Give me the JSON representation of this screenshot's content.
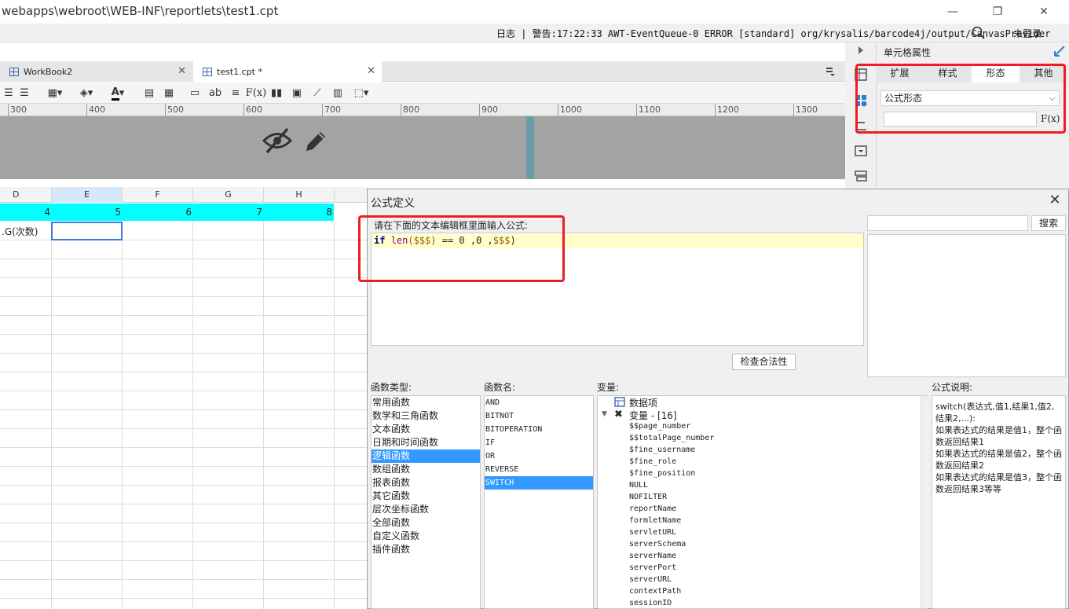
{
  "window": {
    "title": "webapps\\webroot\\WEB-INF\\reportlets\\test1.cpt",
    "minimize": "—",
    "maximize": "❐",
    "close": "✕"
  },
  "logbar": {
    "log_text": "日志 | 警告:17:22:33 AWT-EventQueue-0 ERROR [standard] org/krysalis/barcode4j/output/CanvasProvider",
    "login": "未登录"
  },
  "tabs": [
    {
      "label": "WorkBook2",
      "close": "✕"
    },
    {
      "label": "test1.cpt *",
      "close": "✕"
    }
  ],
  "toolbar": {
    "ab_label": "ab",
    "fx_label": "F(x)"
  },
  "ruler": [
    "300",
    "400",
    "500",
    "600",
    "700",
    "800",
    "900",
    "1000",
    "1100",
    "1200",
    "1300"
  ],
  "columns": [
    "D",
    "E",
    "F",
    "G",
    "H"
  ],
  "cyan_row": [
    "4",
    "5",
    "6",
    "7",
    "8"
  ],
  "cell_d2": ".G(次数)",
  "right_panel": {
    "title": "单元格属性",
    "tabs": [
      "扩展",
      "样式",
      "形态",
      "其他"
    ],
    "active_tab": "形态",
    "select_value": "公式形态",
    "fx_button": "F(x)"
  },
  "dialog": {
    "title": "公式定义",
    "prompt": "请在下面的文本编辑框里面输入公式:",
    "formula": {
      "kw": "if",
      "fn": "len",
      "arg1": "($$$)",
      "rest": " == 0 ,0 ,",
      "arg2": "$$$",
      "close": ")"
    },
    "search_button": "搜索",
    "check_button": "检查合法性",
    "func_type_label": "函数类型:",
    "func_name_label": "函数名:",
    "variable_label": "变量:",
    "desc_label": "公式说明:",
    "func_types": [
      "常用函数",
      "数学和三角函数",
      "文本函数",
      "日期和时间函数",
      "逻辑函数",
      "数组函数",
      "报表函数",
      "其它函数",
      "层次坐标函数",
      "全部函数",
      "自定义函数",
      "插件函数"
    ],
    "selected_type": "逻辑函数",
    "func_names": [
      "AND",
      "BITNOT",
      "BITOPERATION",
      "IF",
      "OR",
      "REVERSE",
      "SWITCH"
    ],
    "selected_name": "SWITCH",
    "tree": {
      "data_items": "数据项",
      "variables": "变量 - [16]"
    },
    "variables": [
      "$$page_number",
      "$$totalPage_number",
      "$fine_username",
      "$fine_role",
      "$fine_position",
      "NULL",
      "NOFILTER",
      "reportName",
      "formletName",
      "servletURL",
      "serverSchema",
      "serverName",
      "serverPort",
      "serverURL",
      "contextPath",
      "sessionID"
    ],
    "description": [
      "switch(表达式,值1,结果1,值2,结果2,...):",
      "如果表达式的结果是值1，整个函数返回结果1",
      "如果表达式的结果是值2，整个函数返回结果2",
      "如果表达式的结果是值3，整个函数返回结果3等等"
    ]
  },
  "colors": {
    "cyan_row": "#00ffff",
    "selection": "#3399ff",
    "highlight_box": "#ee1c25",
    "editor_line": "#ffffcc"
  }
}
